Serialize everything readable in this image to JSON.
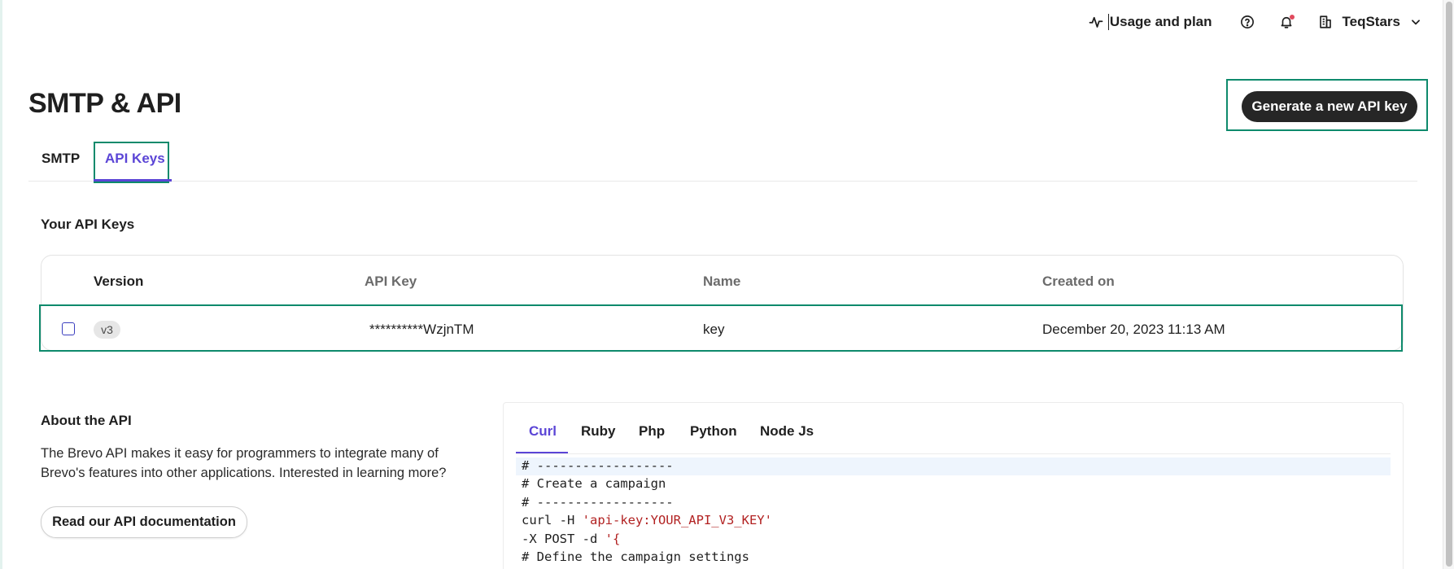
{
  "topbar": {
    "usage_label": "Usage and plan",
    "usage_icon": "activity-icon",
    "help_icon": "help-circle-icon",
    "notifications_icon": "bell-icon",
    "account_name": "TeqStars",
    "account_icon": "building-icon",
    "account_chevron": "chevron-down-icon"
  },
  "page": {
    "title": "SMTP & API",
    "generate_button": "Generate a new API key"
  },
  "tabs": [
    {
      "label": "SMTP",
      "active": false
    },
    {
      "label": "API Keys",
      "active": true
    }
  ],
  "keys": {
    "section_title": "Your API Keys",
    "columns": [
      "Version",
      "API Key",
      "Name",
      "Created on"
    ],
    "rows": [
      {
        "version": "v3",
        "api_key": "**********WzjnTM",
        "name": "key",
        "created_on": "December 20, 2023 11:13 AM"
      }
    ]
  },
  "about": {
    "title": "About the API",
    "text": "The Brevo API makes it easy for programmers to integrate many of Brevo's features into other applications. Interested in learning more?",
    "doc_button": "Read our API documentation"
  },
  "code": {
    "tabs": [
      "Curl",
      "Ruby",
      "Php",
      "Python",
      "Node Js"
    ],
    "active_tab": "Curl",
    "lines": [
      {
        "plain": "# ------------------",
        "str": ""
      },
      {
        "plain": "# Create a campaign",
        "str": ""
      },
      {
        "plain": "# ------------------",
        "str": ""
      },
      {
        "plain": "curl -H ",
        "str": "'api-key:YOUR_API_V3_KEY'"
      },
      {
        "plain": "-X POST -d ",
        "str": "'{"
      },
      {
        "plain": "# Define the campaign settings",
        "str": ""
      }
    ]
  },
  "colors": {
    "accent": "#5b45d6",
    "highlight_border": "#0e8a6c",
    "primary_button": "#262626"
  }
}
